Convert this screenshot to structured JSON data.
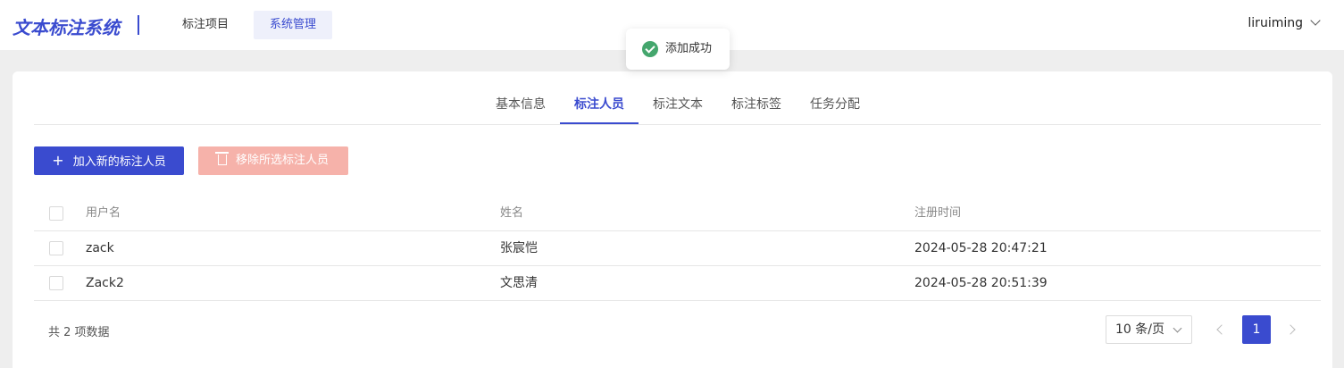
{
  "header": {
    "logo": "文本标注系统",
    "nav": [
      "标注项目",
      "系统管理"
    ],
    "active_nav": "系统管理",
    "username": "liruiming"
  },
  "toast": {
    "message": "添加成功"
  },
  "tabs": [
    "基本信息",
    "标注人员",
    "标注文本",
    "标注标签",
    "任务分配"
  ],
  "active_tab": "标注人员",
  "toolbar": {
    "add_label": "加入新的标注人员",
    "remove_label": "移除所选标注人员"
  },
  "table": {
    "columns": [
      "用户名",
      "姓名",
      "注册时间"
    ],
    "rows": [
      {
        "username": "zack",
        "name": "张宸恺",
        "registered": "2024-05-28 20:47:21"
      },
      {
        "username": "Zack2",
        "name": "文思清",
        "registered": "2024-05-28 20:51:39"
      }
    ]
  },
  "pagination": {
    "total_text": "共 2 项数据",
    "page_size": "10 条/页",
    "current_page": "1"
  },
  "colors": {
    "accent": "#3a4bcf",
    "danger_disabled": "#f6b2aa",
    "success": "#44a66d"
  }
}
